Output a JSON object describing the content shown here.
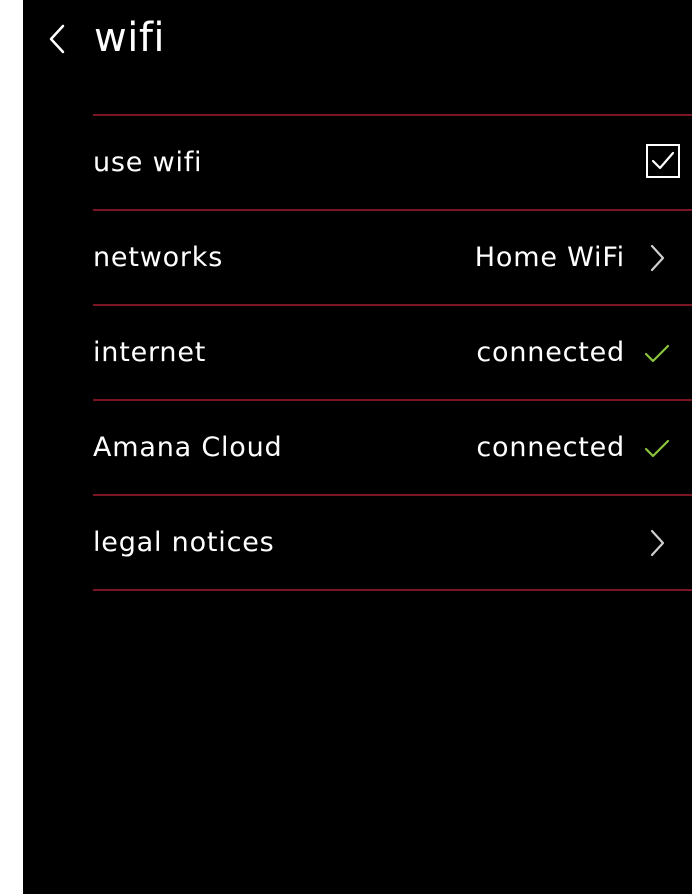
{
  "header": {
    "title": "wifi",
    "back_icon": "chevron-left-icon"
  },
  "colors": {
    "background": "#000000",
    "text": "#ffffff",
    "divider": "#7a1624",
    "success": "#8cc43c"
  },
  "settings": {
    "use_wifi": {
      "label": "use wifi",
      "checked": true
    },
    "networks": {
      "label": "networks",
      "value": "Home WiFi",
      "icon": "chevron-right-icon"
    },
    "internet": {
      "label": "internet",
      "value": "connected",
      "icon": "check-icon"
    },
    "cloud": {
      "label": "Amana Cloud",
      "value": "connected",
      "icon": "check-icon"
    },
    "legal": {
      "label": "legal notices",
      "icon": "chevron-right-icon"
    }
  }
}
